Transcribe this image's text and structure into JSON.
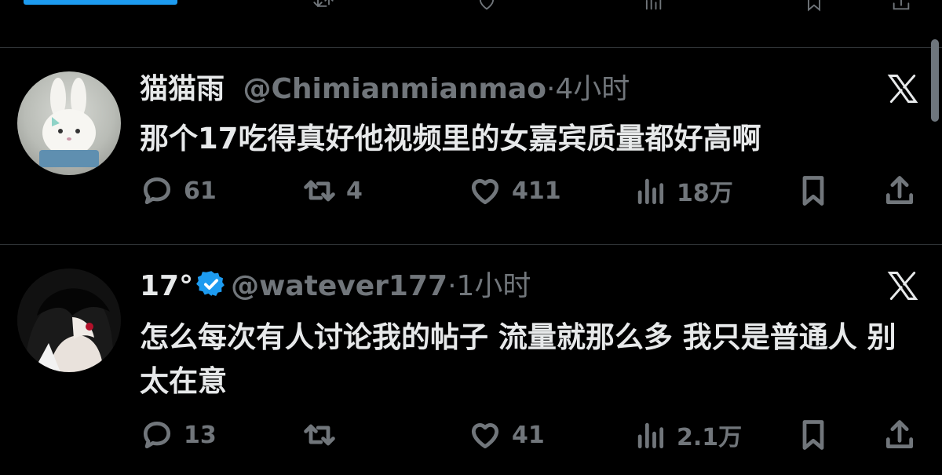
{
  "top_partial": {
    "reply_count": "",
    "retweet_count": "",
    "like_count": "",
    "views": ""
  },
  "tweets": [
    {
      "name": "猫猫雨",
      "handle": "@Chimianmianmao",
      "separator": "·",
      "time": "4小时",
      "verified": false,
      "text": "那个17吃得真好他视频里的女嘉宾质量都好高啊",
      "replies": "61",
      "retweets": "4",
      "likes": "411",
      "views": "18万"
    },
    {
      "name": "17°",
      "handle": "@watever177",
      "separator": "·",
      "time": "1小时",
      "verified": true,
      "text": "怎么每次有人讨论我的帖子 流量就那么多 我只是普通人 别太在意",
      "replies": "13",
      "retweets": "",
      "likes": "41",
      "views": "2.1万"
    }
  ],
  "colors": {
    "background": "#000000",
    "text": "#e7e9ea",
    "muted": "#71767b",
    "accent": "#1d9bf0",
    "divider": "#2f3336"
  },
  "icons": [
    "reply-icon",
    "retweet-icon",
    "like-icon",
    "views-icon",
    "bookmark-icon",
    "share-icon",
    "x-logo-icon",
    "verified-badge-icon"
  ]
}
